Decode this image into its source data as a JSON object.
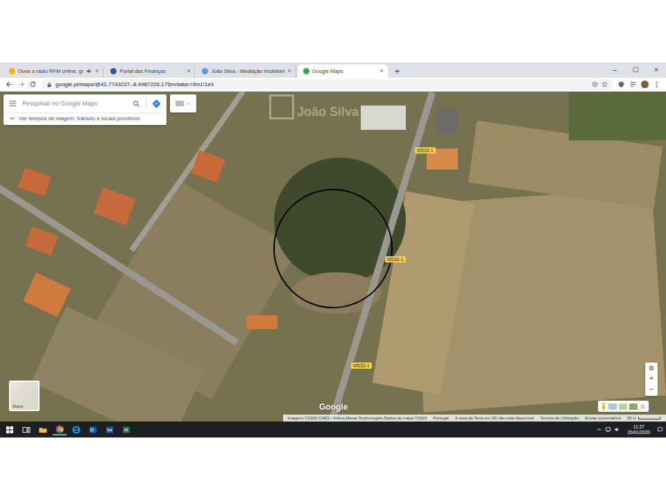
{
  "browser": {
    "tabs": [
      {
        "label": "Ouve a rádio RFM online, gr",
        "selected": false,
        "audio": true
      },
      {
        "label": "Portal das Finanças",
        "selected": false,
        "audio": false
      },
      {
        "label": "João Silva - Mediação Imobiliári",
        "selected": false,
        "audio": false
      },
      {
        "label": "Google Maps",
        "selected": true,
        "audio": false
      }
    ],
    "close_glyph": "×",
    "new_tab": "+",
    "window_controls": [
      "–",
      "☐",
      "×"
    ],
    "address": "google.pt/maps/@41.7743227,-8.4987226,175m/data=!3m1!1e3"
  },
  "map": {
    "search_placeholder": "Pesquisar no Google Maps",
    "directions_hint": "Ver tempos de viagem, trânsito e locais próximos",
    "road_labels": [
      "M533-1",
      "M533-1",
      "M533-1"
    ],
    "watermark": "João Silva",
    "layer_toggle": "Mapa",
    "zoom": [
      "+",
      "−"
    ],
    "logo": "Google",
    "attribution": [
      "Imagens ©2020 CNES / Airbus,Maxar Technologies,Dados do mapa ©2020",
      "Portugal",
      "A vista da Terra em 3D não está disponível",
      "Termos de Utilização",
      "Enviar comentários"
    ],
    "scale": "20 m"
  },
  "taskbar": {
    "time": "11:27",
    "date": "20/01/2020"
  }
}
